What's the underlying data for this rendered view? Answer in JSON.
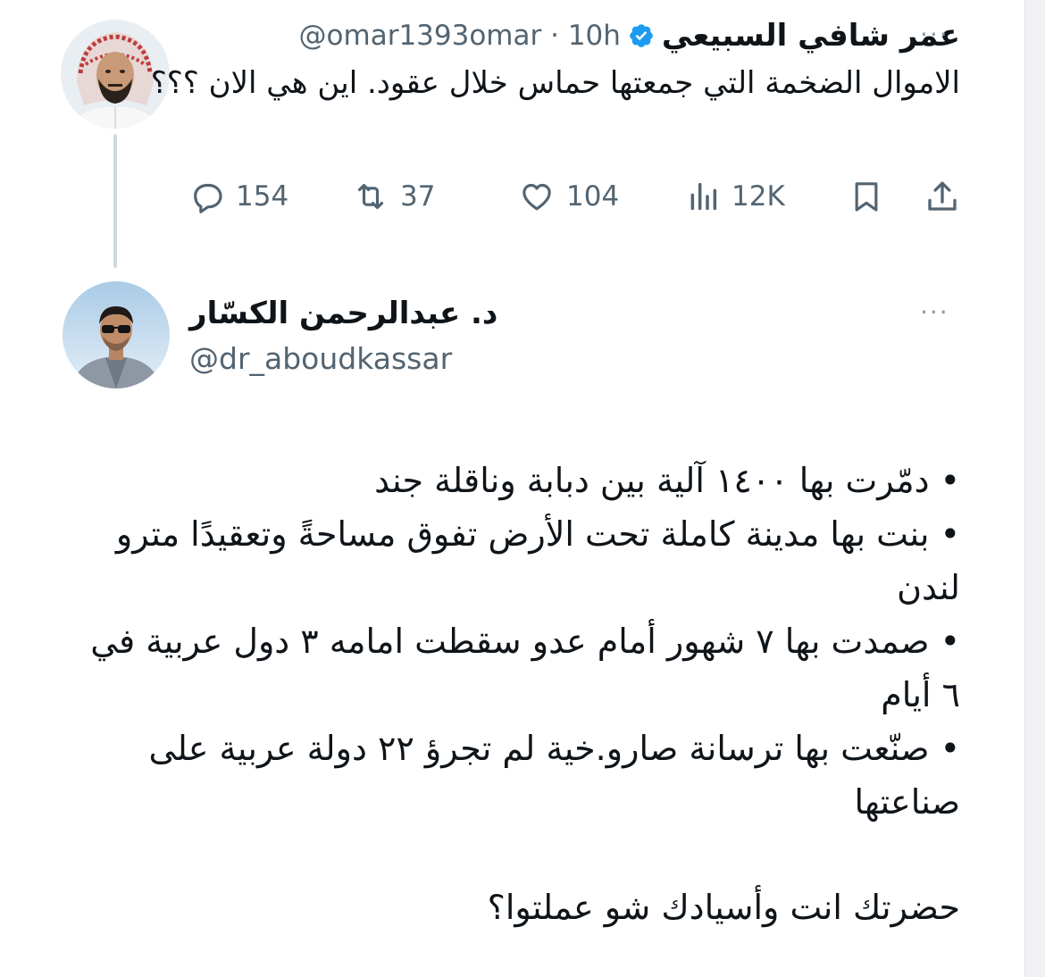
{
  "tweet1": {
    "author_name": "عمر شافي السبيعي",
    "handle_time": "@omar1393omar · 10h",
    "text": "الاموال الضخمة التي جمعتها حماس  خلال عقود.  اين هي الان ؟؟؟",
    "actions": {
      "replies": "154",
      "retweets": "37",
      "likes": "104",
      "views": "12K"
    },
    "more": "···"
  },
  "tweet2": {
    "author_name": "د. عبدالرحمن الكسّار",
    "handle": "@dr_aboudkassar",
    "more": "···",
    "bullets": [
      "• دمّرت بها ١٤٠٠ آلية بين دبابة وناقلة جند",
      "• بنت بها مدينة كاملة تحت الأرض تفوق مساحةً وتعقيدًا مترو لندن",
      "• صمدت بها ٧ شهور أمام عدو سقطت امامه ٣ دول عربية في ٦ أيام",
      "• صنّعت بها ترسانة صارو.خية لم تجرؤ ٢٢ دولة عربية على صناعتها"
    ],
    "closing": "حضرتك انت وأسيادك شو عملتوا؟"
  },
  "colors": {
    "verified": "#1d9bf0",
    "muted": "#536471",
    "text": "#0f1419",
    "thread_line": "#cfd9de"
  },
  "icons": [
    "reply-icon",
    "retweet-icon",
    "like-icon",
    "views-icon",
    "bookmark-icon",
    "share-icon",
    "verified-badge-icon",
    "more-icon"
  ]
}
